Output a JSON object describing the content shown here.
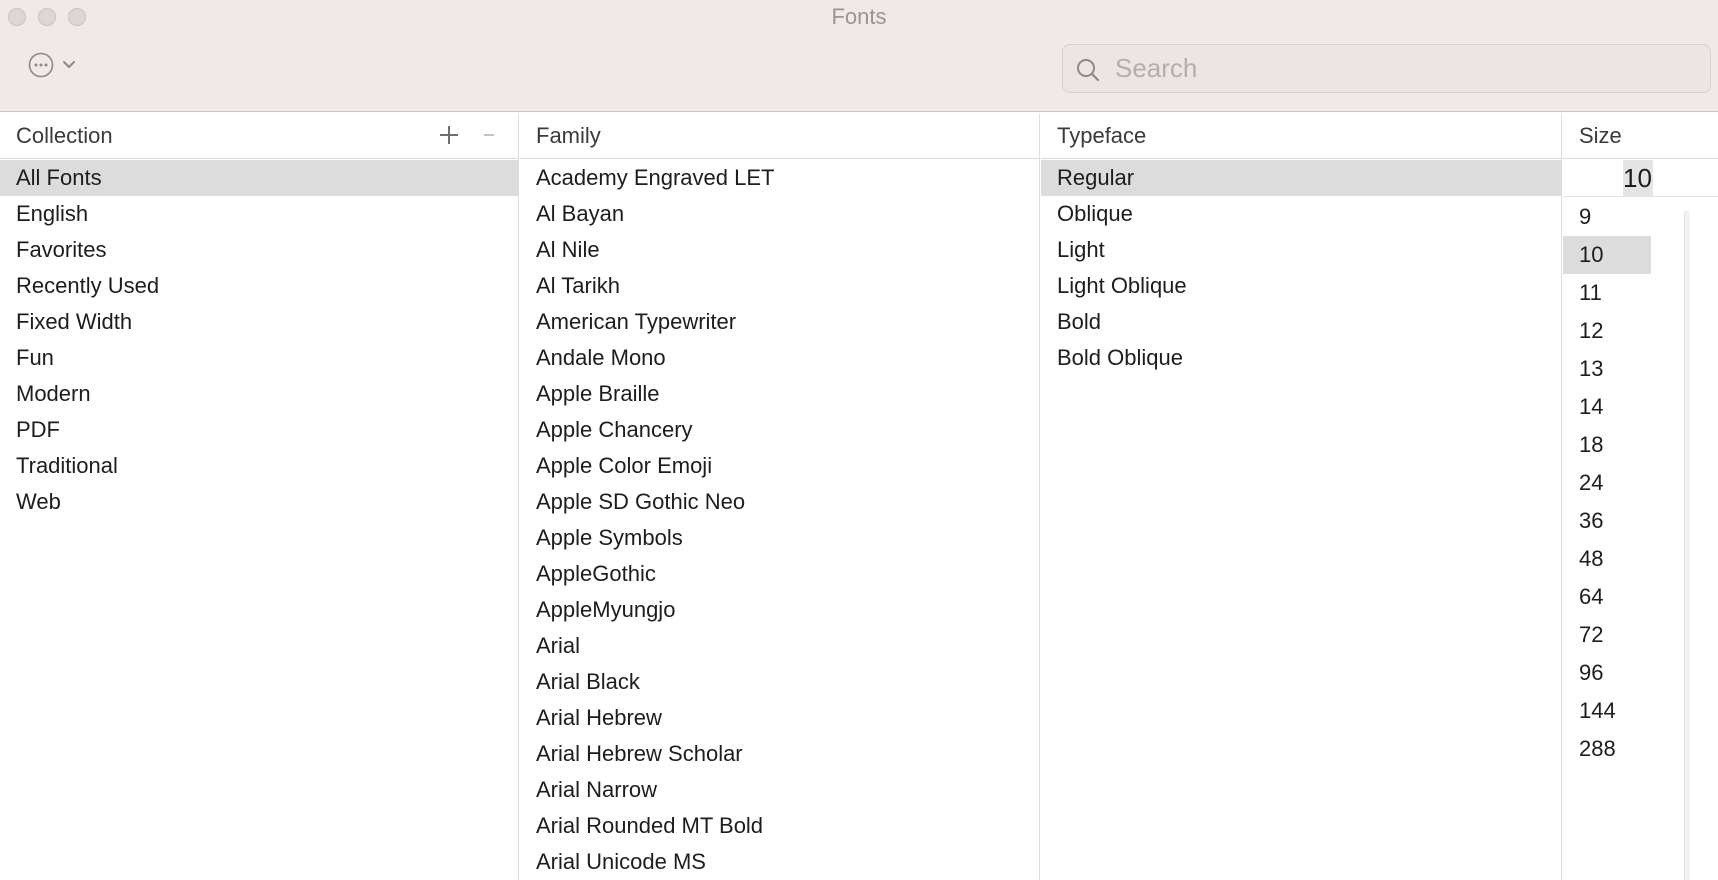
{
  "window": {
    "title": "Fonts"
  },
  "toolbar": {
    "action_icon": "ellipsis-circle-icon",
    "search_placeholder": "Search",
    "search_value": ""
  },
  "collection": {
    "header": "Collection",
    "add_icon": "plus-icon",
    "remove_icon": "minus-icon",
    "items": [
      "All Fonts",
      "English",
      "Favorites",
      "Recently Used",
      "Fixed Width",
      "Fun",
      "Modern",
      "PDF",
      "Traditional",
      "Web"
    ],
    "selected": "All Fonts"
  },
  "family": {
    "header": "Family",
    "items": [
      "Academy Engraved LET",
      "Al Bayan",
      "Al Nile",
      "Al Tarikh",
      "American Typewriter",
      "Andale Mono",
      "Apple Braille",
      "Apple Chancery",
      "Apple Color Emoji",
      "Apple SD Gothic Neo",
      "Apple Symbols",
      "AppleGothic",
      "AppleMyungjo",
      "Arial",
      "Arial Black",
      "Arial Hebrew",
      "Arial Hebrew Scholar",
      "Arial Narrow",
      "Arial Rounded MT Bold",
      "Arial Unicode MS"
    ]
  },
  "typeface": {
    "header": "Typeface",
    "items": [
      "Regular",
      "Oblique",
      "Light",
      "Light Oblique",
      "Bold",
      "Bold Oblique"
    ],
    "selected": "Regular"
  },
  "size": {
    "header": "Size",
    "value": "10",
    "items": [
      "9",
      "10",
      "11",
      "12",
      "13",
      "14",
      "18",
      "24",
      "36",
      "48",
      "64",
      "72",
      "96",
      "144",
      "288"
    ],
    "selected": "10"
  },
  "colors": {
    "titlebar": "#efe9e8",
    "selection": "#dcdcdc"
  }
}
